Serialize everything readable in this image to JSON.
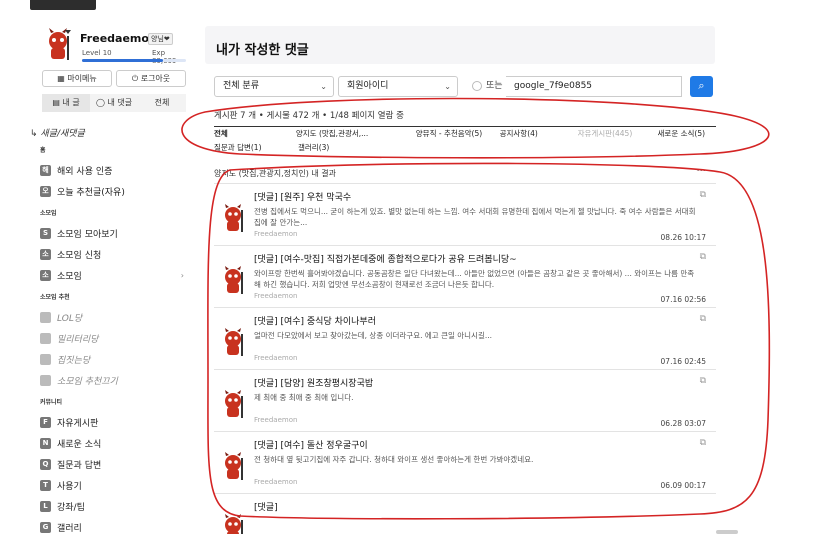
{
  "profile": {
    "name": "Freedaemon",
    "badge": "양님❤",
    "level": "Level 10",
    "exp": "Exp 89,699",
    "exp_progress": 0.78,
    "buttons": [
      "마이메뉴",
      "로그아웃"
    ],
    "button_icons": [
      "grid-icon",
      "power-icon"
    ],
    "tabs": [
      "내 글",
      "내 댓글",
      "전체"
    ]
  },
  "sidebar": {
    "heading": "↳ 새글/새댓글",
    "groups": [
      {
        "label": "홈",
        "items": [
          {
            "icon": "해",
            "label": "해외 사용 인증"
          },
          {
            "icon": "오",
            "label": "오늘 추천글(자유)"
          }
        ]
      },
      {
        "label": "소모임",
        "items": [
          {
            "icon": "S",
            "label": "소모임 모아보기"
          },
          {
            "icon": "소",
            "label": "소모임 신청"
          },
          {
            "icon": "소",
            "label": "소모임",
            "chevron": "›"
          }
        ]
      },
      {
        "label": "소모임 추천",
        "light": true,
        "items": [
          {
            "icon": "",
            "label": "LOL당"
          },
          {
            "icon": "",
            "label": "밀리터리당"
          },
          {
            "icon": "",
            "label": "집짓는당"
          },
          {
            "icon": "",
            "label": "소모임 추천끄기"
          }
        ]
      },
      {
        "label": "커뮤니티",
        "items": [
          {
            "icon": "F",
            "label": "자유게시판"
          },
          {
            "icon": "N",
            "label": "새로운 소식"
          },
          {
            "icon": "Q",
            "label": "질문과 답변"
          },
          {
            "icon": "T",
            "label": "사용기"
          },
          {
            "icon": "L",
            "label": "강좌/팁"
          },
          {
            "icon": "G",
            "label": "갤러리"
          }
        ]
      }
    ]
  },
  "main": {
    "title": "내가 작성한 댓글",
    "search": {
      "category": "전체 분류",
      "field": "회원아이디",
      "or_label": "또는",
      "query": "google_7f9e0855"
    },
    "stats": "게시판 7 개  •  게시물 472 개  •  1/48 페이지 열람 중",
    "categories_row1": [
      {
        "label": "전체",
        "bold": true
      },
      {
        "label": "양지도 (맛집,관광서,..."
      },
      {
        "label": "양뮤직 - 추천음악(5)"
      },
      {
        "label": "공지사항(4)"
      },
      {
        "label": "자유게시판(445)",
        "grey": true
      },
      {
        "label": "새로운 소식(5)"
      }
    ],
    "categories_row2": [
      {
        "label": "질문과 답변(1)"
      },
      {
        "label": "갤러리(3)"
      }
    ],
    "section_title": "양지도 (맛집,관광지,정치인) 내 결과",
    "section_more": "···",
    "posts": [
      {
        "title": "[댓글] [원주] 우천 막국수",
        "body": "전병 집에서도 먹으니... 굳이 하는게 있죠. 별맛 없는데 하는 느낌. 여수 서대회 유명한데 집에서 먹는게 젤 맛납니다. 죽 여수 사람들은 서대회집에 잘 안가는...",
        "author": "Freedaemon",
        "date": "08.26 10:17"
      },
      {
        "title": "[댓글] [여수-맛집] 직접가본데중에 종합적으로다가 공유 드려봅니당~",
        "body": "와이프랑 한번씩 흘어봐야겠습니다. 공동곰창은 일단 다녀왔는데... 아들만 없었으면 (아들은 곰창고 같은 곳 좋아해서) ... 와이프는 나름 만족해 하긴 했습니다. 저희 업맛엔 무선소곰창이 현재로선 조금더 나은듯 합니다.",
        "author": "Freedaemon",
        "date": "07.16 02:56"
      },
      {
        "title": "[댓글] [여수] 중식당 차이나부러",
        "body": "얼마전 다모았에서 보고 찾아갔는데, 상종 이더라구요. 에고 큰일 아니시길...",
        "author": "Freedaemon",
        "date": "07.16 02:45"
      },
      {
        "title": "[댓글] [담양] 원조창평시장국밥",
        "body": "제 최애 중 최애 중 최애 입니다.",
        "author": "Freedaemon",
        "date": "06.28 03:07"
      },
      {
        "title": "[댓글] [여수] 돌산 정우굴구이",
        "body": "전 청하대 옆 뒷고기집에 자주 갑니다. 청하대 와이프 생선 좋아하는게 한번 가봐야겠네요.",
        "author": "Freedaemon",
        "date": "06.09 00:17"
      },
      {
        "title": "[댓글]",
        "body": "",
        "author": "",
        "date": ""
      }
    ]
  },
  "colors": {
    "accent": "#1f7ae6",
    "annotation": "#d42424"
  }
}
